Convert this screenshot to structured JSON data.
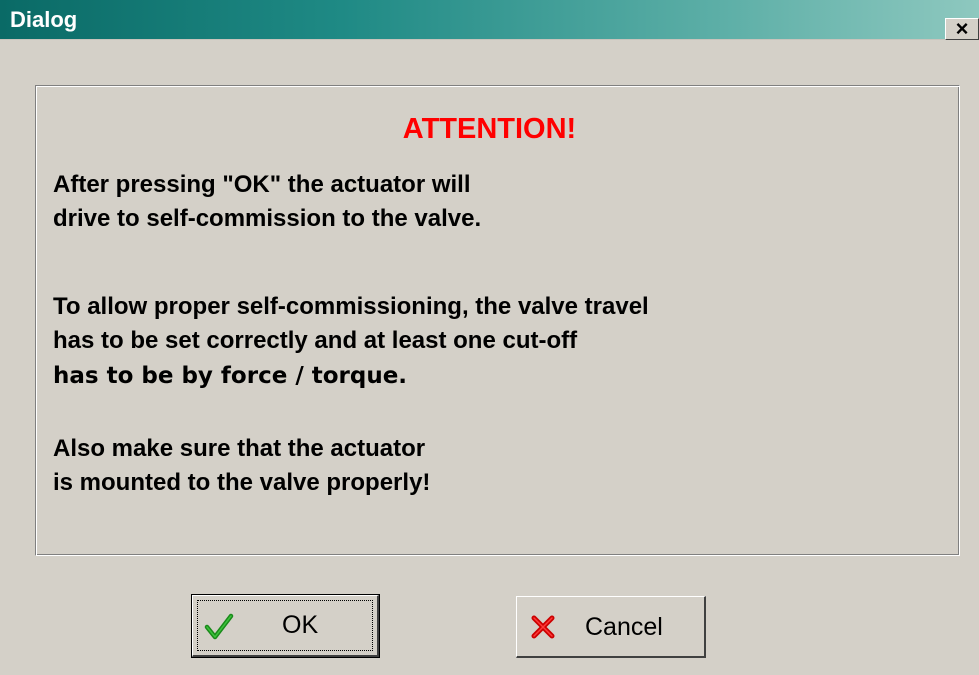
{
  "window": {
    "title": "Dialog",
    "close_glyph": "×"
  },
  "message": {
    "heading": "ATTENTION!",
    "heading_color": "#ff0000",
    "lines": [
      "After pressing \"OK\" the actuator will",
      "drive to self-commission to the valve.",
      "To allow proper self-commissioning, the valve travel",
      "has to be set correctly and at least one cut-off",
      "has to be by force / torque.",
      "Also make sure that the actuator",
      "is mounted to the valve properly!"
    ]
  },
  "buttons": {
    "ok": {
      "label": "OK",
      "icon": "check-icon",
      "icon_color": "#1a8a1a"
    },
    "cancel": {
      "label": "Cancel",
      "icon": "cross-icon",
      "icon_color": "#cc0000"
    }
  },
  "colors": {
    "titlebar_start": "#0a6a66",
    "titlebar_end": "#8ec8bf",
    "face": "#d4d0c8"
  }
}
